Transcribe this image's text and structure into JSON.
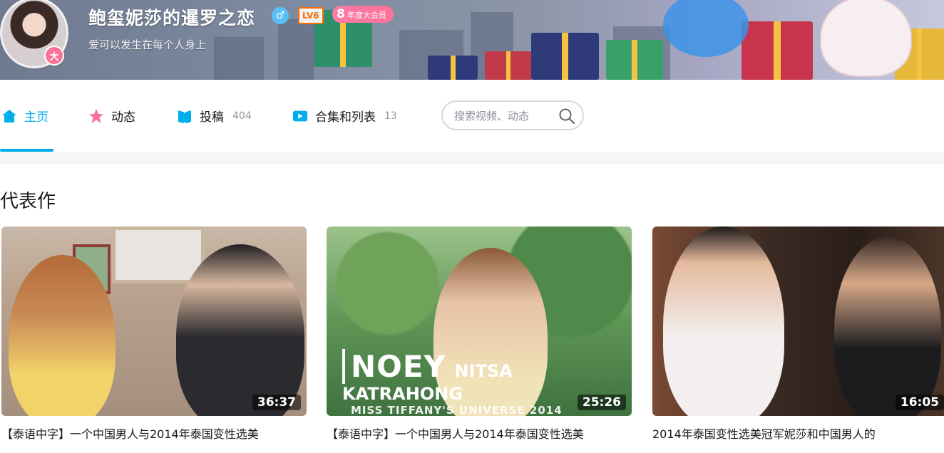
{
  "user": {
    "name": "鲍玺妮莎的暹罗之恋",
    "sex_symbol": "♂",
    "level": "LV6",
    "vip_years": "8",
    "vip_label": "年度大会员",
    "avatar_badge": "大",
    "sign": "爱可以发生在每个人身上"
  },
  "nav": {
    "items": [
      {
        "label": "主页",
        "count": "",
        "icon": "home-icon"
      },
      {
        "label": "动态",
        "count": "",
        "icon": "dynamic-icon"
      },
      {
        "label": "投稿",
        "count": "404",
        "icon": "upload-icon"
      },
      {
        "label": "合集和列表",
        "count": "13",
        "icon": "collection-icon"
      }
    ],
    "active": "主页"
  },
  "search": {
    "placeholder": "搜索视频、动态",
    "value": ""
  },
  "section": {
    "title": "代表作"
  },
  "videos": [
    {
      "duration": "36:37",
      "title": "【泰语中字】一个中国男人与2014年泰国变性选美"
    },
    {
      "duration": "25:26",
      "title": "【泰语中字】一个中国男人与2014年泰国变性选美",
      "overlay_name": "NOEY",
      "overlay_fullname": "NITSA KATRAHONG",
      "overlay_sub": "MISS TIFFANY'S UNIVERSE 2014"
    },
    {
      "duration": "16:05",
      "title": "2014年泰国变性选美冠军妮莎和中国男人的"
    }
  ],
  "colors": {
    "accent": "#00aeec",
    "pink": "#fb7299",
    "level": "#ff6c00"
  }
}
